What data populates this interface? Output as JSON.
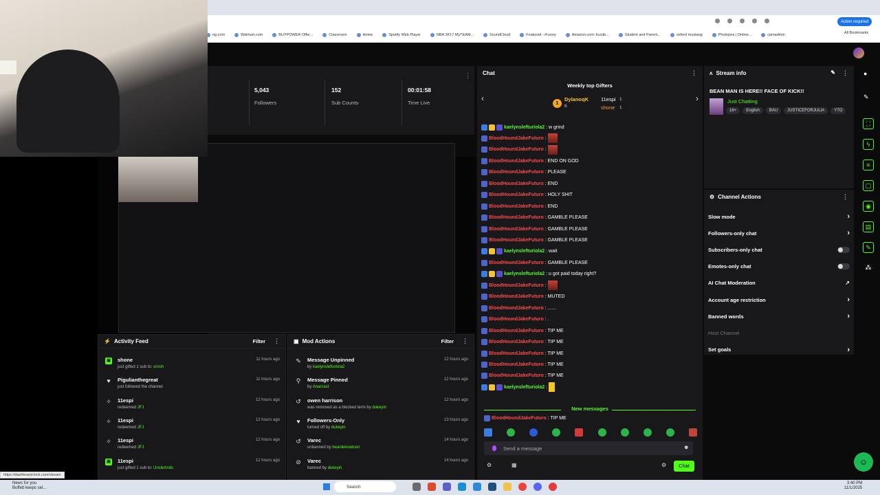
{
  "browser": {
    "bookmarks": [
      "ng.com",
      "Walmart.com",
      "BUYPOWER Offer...",
      "Classroom",
      "Home",
      "Spotify Web Player",
      "NBA 2K17 MyTEAM...",
      "SoundCloud",
      "Featured - iFunny",
      "Amazon.com: fuzzib...",
      "Student and Parent...",
      "oxford mustang",
      "Photopea | Online...",
      "cpmadmin"
    ],
    "action_required": "Action required",
    "all_bookmarks": "All Bookmarks",
    "status_url": "https://dashboard.kick.com/stream"
  },
  "stats": {
    "followers_value": "5,043",
    "followers_label": "Followers",
    "subs_value": "152",
    "subs_label": "Sub Counts",
    "live_value": "00:01:58",
    "live_label": "Time Live"
  },
  "activity": {
    "title": "Activity Feed",
    "filter": "Filter",
    "items": [
      {
        "name": "shone",
        "sub": "just gifted 1 sub to: ",
        "hl": "urosh",
        "time": "11 hours ago",
        "icon": "gift-icon"
      },
      {
        "name": "Pigulianthegreat",
        "sub": "just followed the channel",
        "hl": "",
        "time": "11 hours ago",
        "icon": "heart-icon"
      },
      {
        "name": "11espi",
        "sub": "redeemed ",
        "hl": "JFJ",
        "time": "12 hours ago",
        "icon": "redeem-icon"
      },
      {
        "name": "11espi",
        "sub": "redeemed ",
        "hl": "JFJ",
        "time": "12 hours ago",
        "icon": "redeem-icon"
      },
      {
        "name": "11espi",
        "sub": "redeemed ",
        "hl": "JFJ",
        "time": "12 hours ago",
        "icon": "redeem-icon"
      },
      {
        "name": "11espi",
        "sub": "just gifted 1 sub to: ",
        "hl": "UncleAnds",
        "time": "12 hours ago",
        "icon": "gift-icon"
      }
    ]
  },
  "mod": {
    "title": "Mod Actions",
    "filter": "Filter",
    "items": [
      {
        "name": "Message Unpinned",
        "sub": "by ",
        "hl": "kaelynslefturiola2",
        "time": "12 hours ago",
        "icon": "unpin-icon"
      },
      {
        "name": "Message Pinned",
        "sub": "by ",
        "hl": "Anarcast",
        "time": "12 hours ago",
        "icon": "pin-icon"
      },
      {
        "name": "owen harrison",
        "sub": "was removed as a blocked term by ",
        "hl": "dukeyin",
        "time": "12 hours ago",
        "icon": "undo-icon"
      },
      {
        "name": "Followers-Only",
        "sub": "turned off by ",
        "hl": "dukeyin",
        "time": "13 hours ago",
        "icon": "heart-icon"
      },
      {
        "name": "Varec",
        "sub": "unbanned by ",
        "hl": "beanlekowloon",
        "time": "14 hours ago",
        "icon": "undo-icon"
      },
      {
        "name": "Varec",
        "sub": "banned by ",
        "hl": "dukeyin",
        "time": "14 hours ago",
        "icon": "ban-icon"
      }
    ]
  },
  "chat": {
    "title": "Chat",
    "gifters_title": "Weekly top Gifters",
    "gifter1": "DylanoqK",
    "gifter1_count": "6",
    "gifter2": "11espi",
    "gifter2_count": "1",
    "gifter3": "shone",
    "gifter3_count": "1",
    "new_messages": "New messages",
    "placeholder": "Send a message",
    "send": "Chat",
    "messages": [
      {
        "user": "kaelynslefturiola2",
        "color": "green",
        "text": ": w grind",
        "emote": false
      },
      {
        "user": "BloodHoundJakeFuturo",
        "color": "red",
        "text": ":",
        "emote": true
      },
      {
        "user": "BloodHoundJakeFuturo",
        "color": "red",
        "text": ":",
        "emote": true
      },
      {
        "user": "BloodHoundJakeFuturo",
        "color": "red",
        "text": ": END ON GOD",
        "emote": false
      },
      {
        "user": "BloodHoundJakeFuturo",
        "color": "red",
        "text": ": PLEASE",
        "emote": false
      },
      {
        "user": "BloodHoundJakeFuturo",
        "color": "red",
        "text": ": END",
        "emote": false
      },
      {
        "user": "BloodHoundJakeFuturo",
        "color": "red",
        "text": ": HOLY SHIT",
        "emote": false
      },
      {
        "user": "BloodHoundJakeFuturo",
        "color": "red",
        "text": ": END",
        "emote": false
      },
      {
        "user": "BloodHoundJakeFuturo",
        "color": "red",
        "text": ": GAMBLE PLEASE",
        "emote": false
      },
      {
        "user": "BloodHoundJakeFuturo",
        "color": "red",
        "text": ": GAMBLE PLEASE",
        "emote": false
      },
      {
        "user": "BloodHoundJakeFuturo",
        "color": "red",
        "text": ": GAMBLE PLEASE",
        "emote": false
      },
      {
        "user": "kaelynslefturiola2",
        "color": "green",
        "text": ": wait",
        "emote": false
      },
      {
        "user": "BloodHoundJakeFuturo",
        "color": "red",
        "text": ": GAMBLE PLEASE",
        "emote": false
      },
      {
        "user": "kaelynslefturiola2",
        "color": "green",
        "text": ": u got paid today right?",
        "emote": false
      },
      {
        "user": "BloodHoundJakeFuturo",
        "color": "red",
        "text": ":",
        "emote": true
      },
      {
        "user": "BloodHoundJakeFuturo",
        "color": "red",
        "text": ": MUTED",
        "emote": false
      },
      {
        "user": "BloodHoundJakeFuturo",
        "color": "red",
        "text": ": ......",
        "emote": false
      },
      {
        "user": "BloodHoundJakeFuturo",
        "color": "red",
        "text": ": .",
        "emote": false
      },
      {
        "user": "BloodHoundJakeFuturo",
        "color": "red",
        "text": ": TIP ME",
        "emote": false
      },
      {
        "user": "BloodHoundJakeFuturo",
        "color": "red",
        "text": ": TIP ME",
        "emote": false
      },
      {
        "user": "BloodHoundJakeFuturo",
        "color": "red",
        "text": ": TIP ME",
        "emote": false
      },
      {
        "user": "BloodHoundJakeFuturo",
        "color": "red",
        "text": ": TIP ME",
        "emote": false
      },
      {
        "user": "BloodHoundJakeFuturo",
        "color": "red",
        "text": ": TIP ME",
        "emote": false
      },
      {
        "user": "kaelynslefturiola2",
        "color": "green",
        "text": ":",
        "emote": "yellow"
      }
    ],
    "after_new": {
      "user": "BloodHoundJakeFuturo",
      "text": ": TIP ME"
    }
  },
  "stream_info": {
    "title": "Stream info",
    "stream_title": "BEAN MAN IS HERE!! FACE OF KICK!!",
    "category": "Just Chatting",
    "tags": [
      "18+",
      "English",
      "BAU",
      "JUSTICEFORJULIA",
      "YTO"
    ]
  },
  "channel_actions": {
    "title": "Channel Actions",
    "items": [
      {
        "label": "Slow mode",
        "kind": "chevron"
      },
      {
        "label": "Followers-only chat",
        "kind": "chevron"
      },
      {
        "label": "Subscribers-only chat",
        "kind": "toggle"
      },
      {
        "label": "Emotes-only chat",
        "kind": "toggle"
      },
      {
        "label": "AI Chat Moderation",
        "kind": "external"
      },
      {
        "label": "Account age restriction",
        "kind": "chevron"
      },
      {
        "label": "Banned words",
        "kind": "chevron"
      },
      {
        "label": "Host Channel",
        "kind": "dim"
      },
      {
        "label": "Set goals",
        "kind": "chevron"
      }
    ]
  },
  "taskbar": {
    "search": "Search",
    "news_line1": "News for you",
    "news_line2": "Buffett keeps sel...",
    "time": "3:40 PM",
    "date": "11/1/2025"
  },
  "colors": {
    "accent": "#53fc18",
    "panel": "#18181b",
    "bg": "#0b0b0c",
    "chat_red": "#ff4a4a"
  }
}
